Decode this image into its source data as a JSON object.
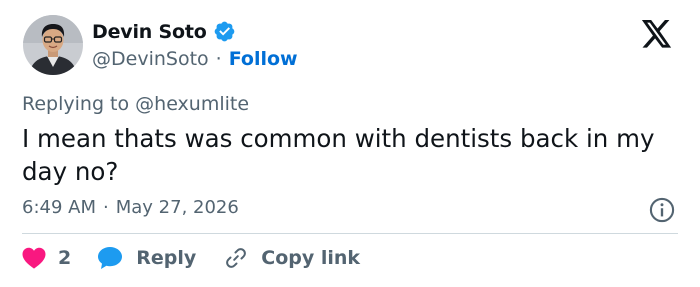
{
  "author": {
    "name": "Devin Soto",
    "handle": "@DevinSoto",
    "separator": "·",
    "follow_label": "Follow"
  },
  "tweet": {
    "replying_prefix": "Replying to ",
    "replying_to": "@hexumlite",
    "text": "I mean thats was common with dentists back in my day no?",
    "time": "6:49 AM",
    "separator": "·",
    "date": "May 27, 2026"
  },
  "actions": {
    "like_count": "2",
    "reply_label": "Reply",
    "copy_label": "Copy link"
  },
  "icons": {
    "logo": "x-logo-icon",
    "verified": "verified-badge-icon",
    "info": "info-icon",
    "like": "heart-icon",
    "reply": "reply-bubble-icon",
    "copy": "link-icon"
  },
  "colors": {
    "text": "#0f1419",
    "muted": "#536471",
    "link": "#006fd6",
    "verified": "#1d9bf0",
    "like": "#f91880",
    "reply": "#1d9bf0",
    "divider": "#cfd9de"
  }
}
